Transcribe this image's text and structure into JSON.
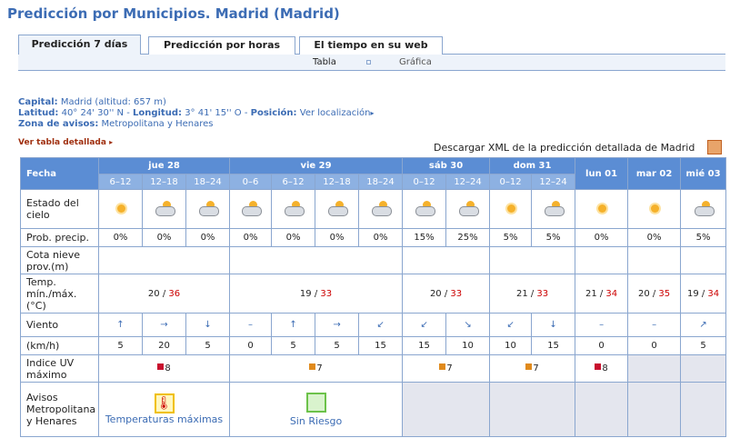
{
  "title": "Predicción por Municipios. Madrid (Madrid)",
  "tabs": [
    "Predicción 7 días",
    "Predicción por horas",
    "El tiempo en su web"
  ],
  "subtabs": {
    "tabla": "Tabla",
    "grafica": "Gráfica"
  },
  "info": {
    "capital_label": "Capital:",
    "capital_value": "Madrid (altitud: 657 m)",
    "lat_label": "Latitud:",
    "lat_value": "40° 24' 30'' N",
    "lon_label": "Longitud:",
    "lon_value": "3° 41' 15'' O",
    "pos_label": "Posición:",
    "pos_value": "Ver localización",
    "zona_label": "Zona de avisos:",
    "zona_value": "Metropolitana y Henares"
  },
  "ver_tabla": "Ver tabla detallada",
  "xml_link": "Descargar XML de la predicción detallada de Madrid",
  "table": {
    "fecha": "Fecha",
    "days": [
      "jue 28",
      "vie 29",
      "sáb 30",
      "dom 31",
      "lun 01",
      "mar 02",
      "mié 03"
    ],
    "periods": [
      "6–12",
      "12–18",
      "18–24",
      "0–6",
      "6–12",
      "12–18",
      "18–24",
      "0–12",
      "12–24",
      "0–12",
      "12–24"
    ],
    "labels": {
      "estado": "Estado del cielo",
      "prob": "Prob. precip.",
      "cota": "Cota nieve prov.(m)",
      "temp": "Temp. mín./máx. (°C)",
      "viento": "Viento",
      "kmh": "(km/h)",
      "uv": "Indice UV máximo",
      "avisos": "Avisos Metropolitana y Henares"
    },
    "prob": [
      "0%",
      "0%",
      "0%",
      "0%",
      "0%",
      "0%",
      "0%",
      "15%",
      "25%",
      "5%",
      "5%",
      "0%",
      "0%",
      "5%"
    ],
    "temps": [
      {
        "min": "20",
        "max": "36"
      },
      {
        "min": "19",
        "max": "33"
      },
      {
        "min": "20",
        "max": "33"
      },
      {
        "min": "21",
        "max": "33"
      },
      {
        "min": "21",
        "max": "34"
      },
      {
        "min": "20",
        "max": "35"
      },
      {
        "min": "19",
        "max": "34"
      }
    ],
    "temp_sep": " / ",
    "wind_arrows": [
      "↑",
      "→",
      "↓",
      "–",
      "↑",
      "→",
      "↙",
      "↙",
      "↘",
      "↙",
      "↓",
      "–",
      "–",
      "↗"
    ],
    "wind_speed": [
      "5",
      "20",
      "5",
      "0",
      "5",
      "5",
      "15",
      "15",
      "10",
      "10",
      "15",
      "0",
      "0",
      "5"
    ],
    "uv": [
      "8",
      "7",
      "7",
      "7",
      "8"
    ],
    "uv_colors": [
      "#c8102e",
      "#e08a1c",
      "#e08a1c",
      "#e08a1c",
      "#c8102e"
    ],
    "avisos": [
      {
        "text": "Temperaturas máximas"
      },
      {
        "text": "Sin Riesgo"
      }
    ]
  }
}
